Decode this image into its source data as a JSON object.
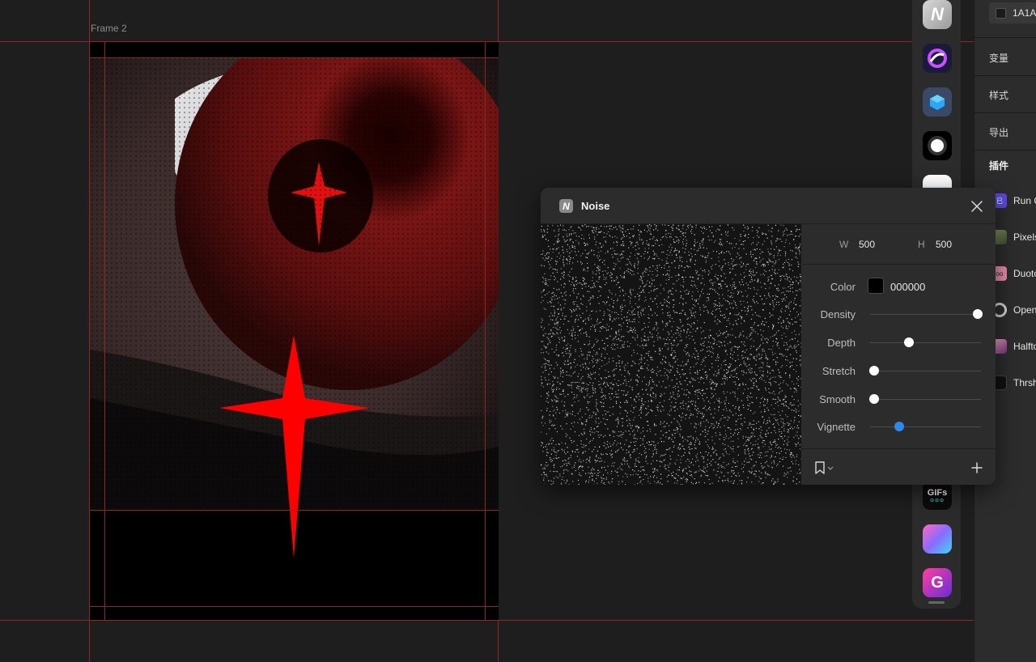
{
  "canvas": {
    "frame_label": "Frame 2"
  },
  "dock": {
    "icons": [
      {
        "name": "noise-plugin-icon",
        "glyph": "N"
      },
      {
        "name": "swirl-plugin-icon",
        "glyph": ""
      },
      {
        "name": "cube-plugin-icon",
        "glyph": ""
      },
      {
        "name": "glow-plugin-icon",
        "glyph": ""
      },
      {
        "name": "gradient-orb-plugin-icon",
        "glyph": ""
      },
      {
        "name": "gifs-plugin-icon",
        "glyph": "GIFs"
      },
      {
        "name": "mesh-gradient-plugin-icon",
        "glyph": ""
      },
      {
        "name": "g-plugin-icon",
        "glyph": "G"
      }
    ]
  },
  "right_panel": {
    "fill_value": "1A1A1",
    "sections": [
      "变量",
      "样式",
      "导出",
      "插件"
    ],
    "plugins": [
      {
        "label": "Run C",
        "icon_glyph": "已",
        "color": "#5b4be0"
      },
      {
        "label": "Pixels",
        "icon_glyph": "",
        "color": "#5c6a4a"
      },
      {
        "label": "Duoto",
        "icon_glyph": "oo",
        "color": "#e98aa6"
      },
      {
        "label": "Open",
        "icon_glyph": "",
        "color": "#cfcfcf"
      },
      {
        "label": "Halfto",
        "icon_glyph": "",
        "color": "#d06080"
      },
      {
        "label": "Thrsh",
        "icon_glyph": "",
        "color": "#111111"
      }
    ]
  },
  "noise": {
    "logo_glyph": "N",
    "title": "Noise",
    "width_label": "W",
    "width_value": "500",
    "height_label": "H",
    "height_value": "500",
    "color_label": "Color",
    "color_value": "000000",
    "sliders": [
      {
        "label": "Density",
        "value": 0.97,
        "accent": false
      },
      {
        "label": "Depth",
        "value": 0.35,
        "accent": false
      },
      {
        "label": "Stretch",
        "value": 0.04,
        "accent": false
      },
      {
        "label": "Smooth",
        "value": 0.04,
        "accent": false
      },
      {
        "label": "Vignette",
        "value": 0.26,
        "accent": true
      }
    ]
  },
  "colors": {
    "guide": "#8b2a22",
    "accent": "#2f88ee",
    "star": "#ff0000"
  }
}
